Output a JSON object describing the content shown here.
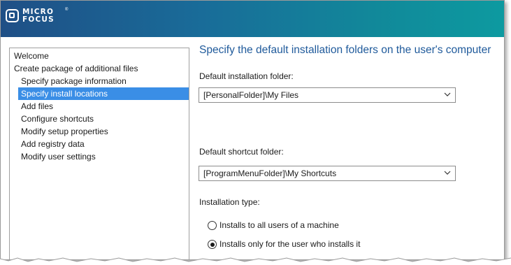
{
  "brand": {
    "line1": "MICRO",
    "line2": "FOCUS",
    "reg": "®"
  },
  "nav": {
    "items": [
      {
        "label": "Welcome",
        "indent": false,
        "selected": false
      },
      {
        "label": "Create package of additional files",
        "indent": false,
        "selected": false
      },
      {
        "label": "Specify package information",
        "indent": true,
        "selected": false
      },
      {
        "label": "Specify install locations",
        "indent": true,
        "selected": true
      },
      {
        "label": "Add files",
        "indent": true,
        "selected": false
      },
      {
        "label": "Configure shortcuts",
        "indent": true,
        "selected": false
      },
      {
        "label": "Modify setup properties",
        "indent": true,
        "selected": false
      },
      {
        "label": "Add registry data",
        "indent": true,
        "selected": false
      },
      {
        "label": "Modify user settings",
        "indent": true,
        "selected": false
      }
    ]
  },
  "page": {
    "title": "Specify the default installation folders on the user's computer",
    "install_folder_label": "Default installation folder:",
    "install_folder_value": "[PersonalFolder]\\My Files",
    "shortcut_folder_label": "Default shortcut folder:",
    "shortcut_folder_value": "[ProgramMenuFolder]\\My Shortcuts",
    "install_type_label": "Installation type:",
    "options": [
      {
        "label": "Installs to all users of a machine",
        "checked": false
      },
      {
        "label": "Installs only for the user who installs it",
        "checked": true
      }
    ]
  },
  "colors": {
    "header_start": "#1f4f86",
    "header_end": "#0d9aa0",
    "selection": "#3a8ee6",
    "title": "#1f5a9b"
  }
}
